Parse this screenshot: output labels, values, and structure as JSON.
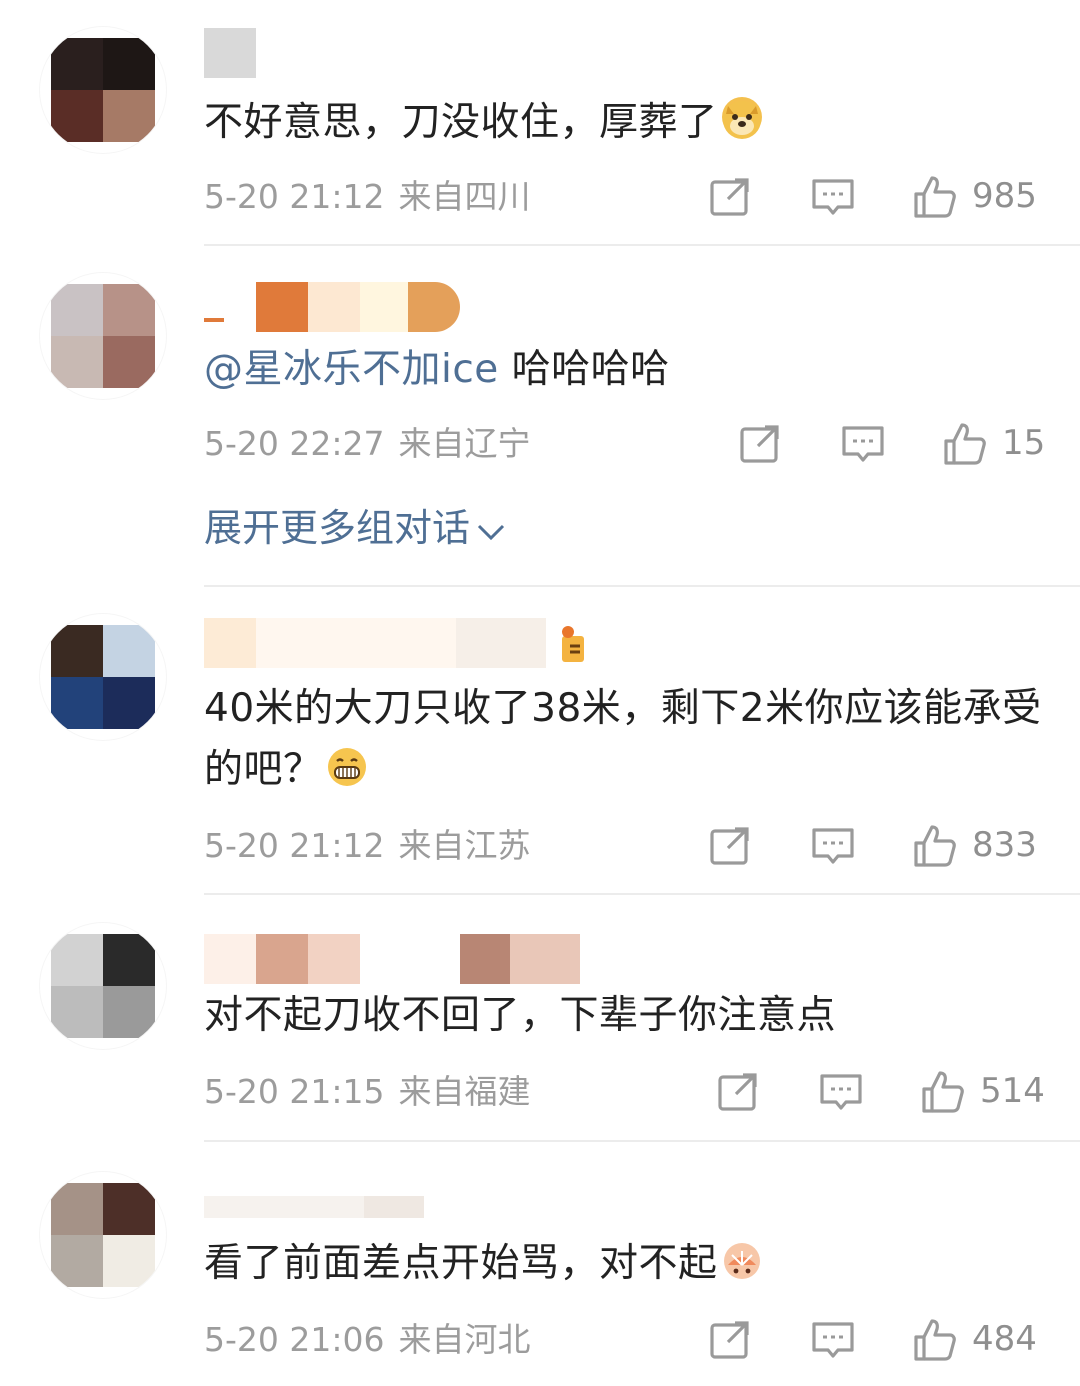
{
  "colors": {
    "link": "#4f6f94",
    "meta": "#9c9c9c",
    "text": "#222222",
    "divider": "#ececec"
  },
  "comments": [
    {
      "text": "不好意思，刀没收住，厚葬了",
      "emoji": "doge-emoji",
      "date": "5-20 21:12",
      "location": "来自四川",
      "likes": "985",
      "avatar_colors": [
        "#2a1f1e",
        "#1e1715",
        "#5a2d26",
        "#a67a66"
      ],
      "name_colors": [
        "#d9d9d9",
        "#ffffff"
      ]
    },
    {
      "mention": "@星冰乐不加ice",
      "text": " 哈哈哈哈",
      "date": "5-20 22:27",
      "location": "来自辽宁",
      "likes": "15",
      "expand_label": "展开更多组对话",
      "avatar_colors": [
        "#c9c2c4",
        "#b79288",
        "#c8b9b3",
        "#9a6a60"
      ],
      "name_colors": [
        "#e07a3a",
        "#fde8d2",
        "#fff6df",
        "#e4a05a"
      ]
    },
    {
      "text": "40米的大刀只收了38米，剩下2米你应该能承受的吧？",
      "emoji": "grin-emoji",
      "date": "5-20 21:12",
      "location": "来自江苏",
      "likes": "833",
      "avatar_colors": [
        "#3a2a22",
        "#c4d3e3",
        "#22427a",
        "#1c2c5a"
      ],
      "name_colors": [
        "#fdebd6",
        "#fff7ef",
        "#f6efe8"
      ]
    },
    {
      "text": "对不起刀收不回了，下辈子你注意点",
      "date": "5-20 21:15",
      "location": "来自福建",
      "likes": "514",
      "avatar_colors": [
        "#d2d2d2",
        "#2a2a2a",
        "#bcbcbc",
        "#9a9a9a"
      ],
      "name_colors": [
        "#fdf0e8",
        "#d9a58e",
        "#f2d2c3",
        "#b88674",
        "#e9c7b8"
      ]
    },
    {
      "text": "看了前面差点开始骂，对不起",
      "emoji": "fan-emoji",
      "date": "5-20 21:06",
      "location": "来自河北",
      "likes": "484",
      "avatar_colors": [
        "#a59287",
        "#4d2f28",
        "#b2aaa2",
        "#f0ece4"
      ],
      "name_colors": [
        "#f6f2ee",
        "#efe8e2"
      ]
    }
  ],
  "icons": {
    "share": "share-icon",
    "comment": "comment-icon",
    "like": "like-icon",
    "expand": "chevron-down-icon"
  }
}
